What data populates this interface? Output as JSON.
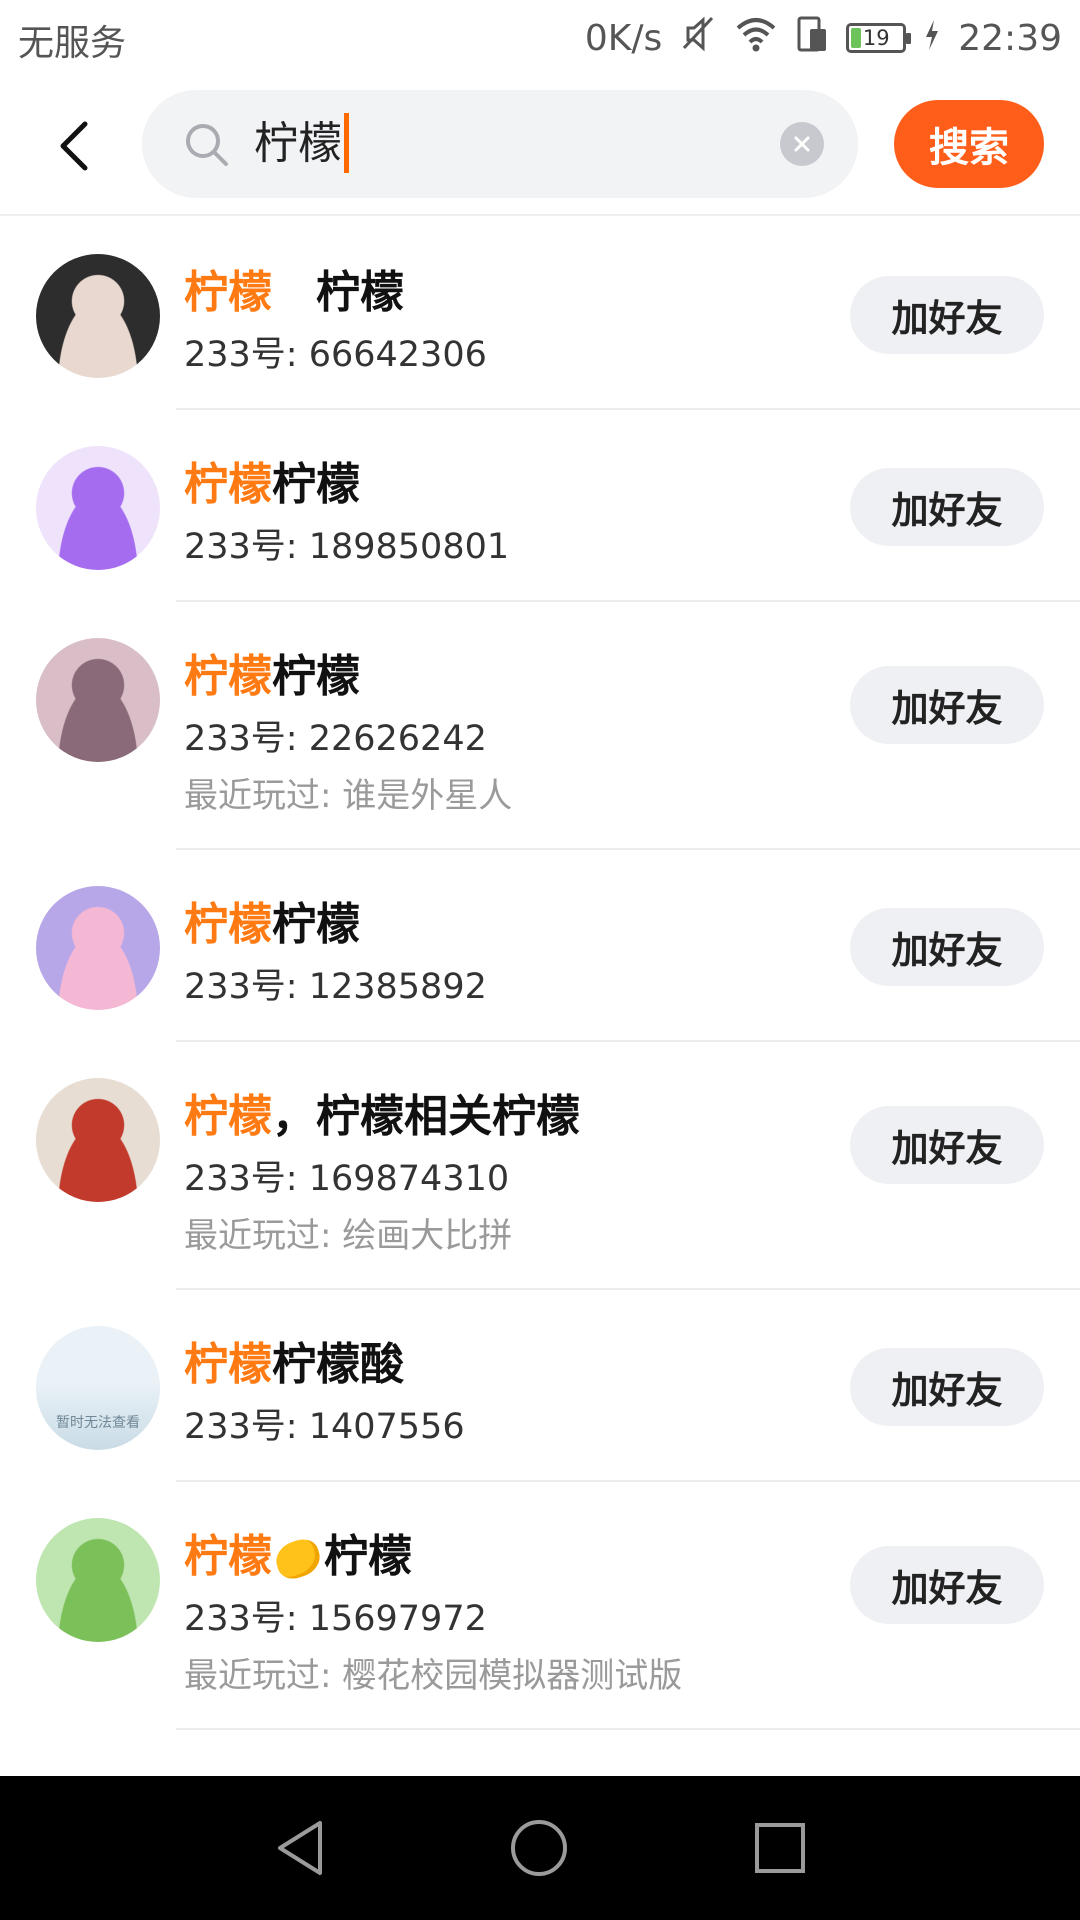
{
  "status_bar": {
    "carrier": "无服务",
    "net_speed": "0K/s",
    "battery": "19",
    "time": "22:39"
  },
  "search": {
    "query": "柠檬",
    "button_label": "搜索"
  },
  "results": [
    {
      "highlight": "柠檬",
      "rest": "　柠檬",
      "uid": "233号: 66642306",
      "played": "",
      "add_label": "加好友",
      "avatar_colors": [
        "#2d2d2d",
        "#e8d8cf"
      ]
    },
    {
      "highlight": "柠檬",
      "rest": "柠檬",
      "uid": "233号: 189850801",
      "played": "",
      "add_label": "加好友",
      "avatar_colors": [
        "#efe3fb",
        "#a66cf0"
      ]
    },
    {
      "highlight": "柠檬",
      "rest": "柠檬",
      "uid": "233号: 22626242",
      "played": "最近玩过: 谁是外星人",
      "add_label": "加好友",
      "avatar_colors": [
        "#d9bec8",
        "#8a6a78"
      ]
    },
    {
      "highlight": "柠檬",
      "rest": "柠檬",
      "uid": "233号: 12385892",
      "played": "",
      "add_label": "加好友",
      "avatar_colors": [
        "#b8a7e8",
        "#f4b7d4"
      ]
    },
    {
      "highlight": "柠檬",
      "rest": "，柠檬相关柠檬",
      "uid": "233号: 169874310",
      "played": "最近玩过: 绘画大比拼",
      "add_label": "加好友",
      "avatar_colors": [
        "#e7ddd2",
        "#c23a2c"
      ]
    },
    {
      "highlight": "柠檬",
      "rest": "柠檬酸",
      "uid": "233号: 1407556",
      "played": "",
      "add_label": "加好友",
      "avatar_colors": [
        "#eaf2f7",
        "#c9dbe6"
      ],
      "avatar_text": "暂时无法查看"
    },
    {
      "highlight": "柠檬",
      "rest": "柠檬",
      "uid": "233号: 15697972",
      "played": "最近玩过: 樱花校园模拟器测试版",
      "add_label": "加好友",
      "avatar_colors": [
        "#bfe6b1",
        "#7cc05a"
      ],
      "has_lemon": true
    }
  ]
}
